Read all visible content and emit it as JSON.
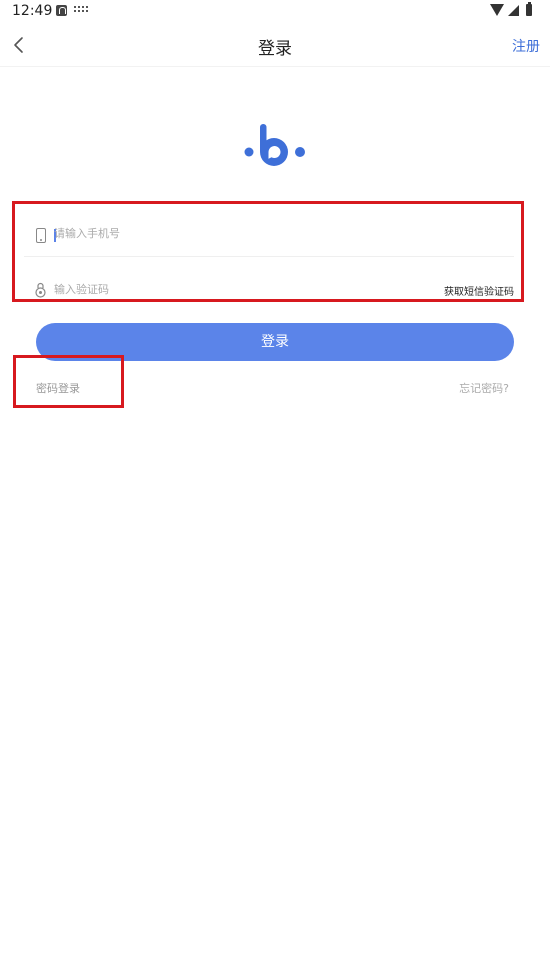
{
  "status_bar": {
    "time": "12:49",
    "icons": [
      "notification-a-icon",
      "keyboard-icon",
      "wifi-icon",
      "cell-signal-icon",
      "battery-icon"
    ]
  },
  "header": {
    "title": "登录",
    "register_label": "注册",
    "back_icon": "chevron-left-icon"
  },
  "logo": {
    "icon": "brand-b-logo",
    "color": "#3e6fd8"
  },
  "form": {
    "phone_placeholder": "请输入手机号",
    "code_placeholder": "输入验证码",
    "sms_button_label": "获取短信验证码",
    "phone_icon": "phone-icon",
    "lock_icon": "lock-icon"
  },
  "login_button_label": "登录",
  "links": {
    "password_login": "密码登录",
    "forgot_password": "忘记密码?"
  },
  "colors": {
    "accent": "#5b84e9",
    "link": "#3e6fd8",
    "highlight_box": "#d7191f"
  }
}
